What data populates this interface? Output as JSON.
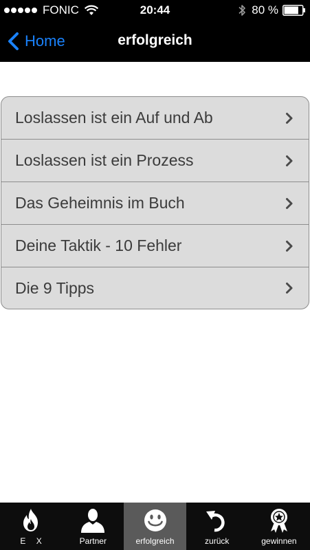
{
  "status_bar": {
    "carrier": "FONIC",
    "time": "20:44",
    "battery_percent": "80 %",
    "signal_strength": 5,
    "battery_level": 0.8,
    "icons": [
      "signal-dots-icon",
      "wifi-icon",
      "bluetooth-icon",
      "battery-icon"
    ]
  },
  "nav": {
    "back_label": "Home",
    "title": "erfolgreich"
  },
  "list": {
    "items": [
      {
        "label": "Loslassen ist ein Auf und Ab"
      },
      {
        "label": "Loslassen ist ein Prozess"
      },
      {
        "label": "Das Geheimnis im Buch"
      },
      {
        "label": "Deine Taktik - 10 Fehler"
      },
      {
        "label": "Die 9 Tipps"
      }
    ]
  },
  "tab_bar": {
    "active": "erfolgreich",
    "tabs": [
      {
        "label": "E X",
        "icon": "flame-icon"
      },
      {
        "label": "Partner",
        "icon": "person-icon"
      },
      {
        "label": "erfolgreich",
        "icon": "smiley-icon"
      },
      {
        "label": "zurück",
        "icon": "undo-arrow-icon"
      },
      {
        "label": "gewinnen",
        "icon": "award-ribbon-icon"
      }
    ]
  },
  "colors": {
    "accent": "#1a82fb",
    "bar_background": "#000000",
    "list_background": "#dcdcdc",
    "list_border": "#8c8c8c",
    "active_tab": "#5a5a5a"
  }
}
